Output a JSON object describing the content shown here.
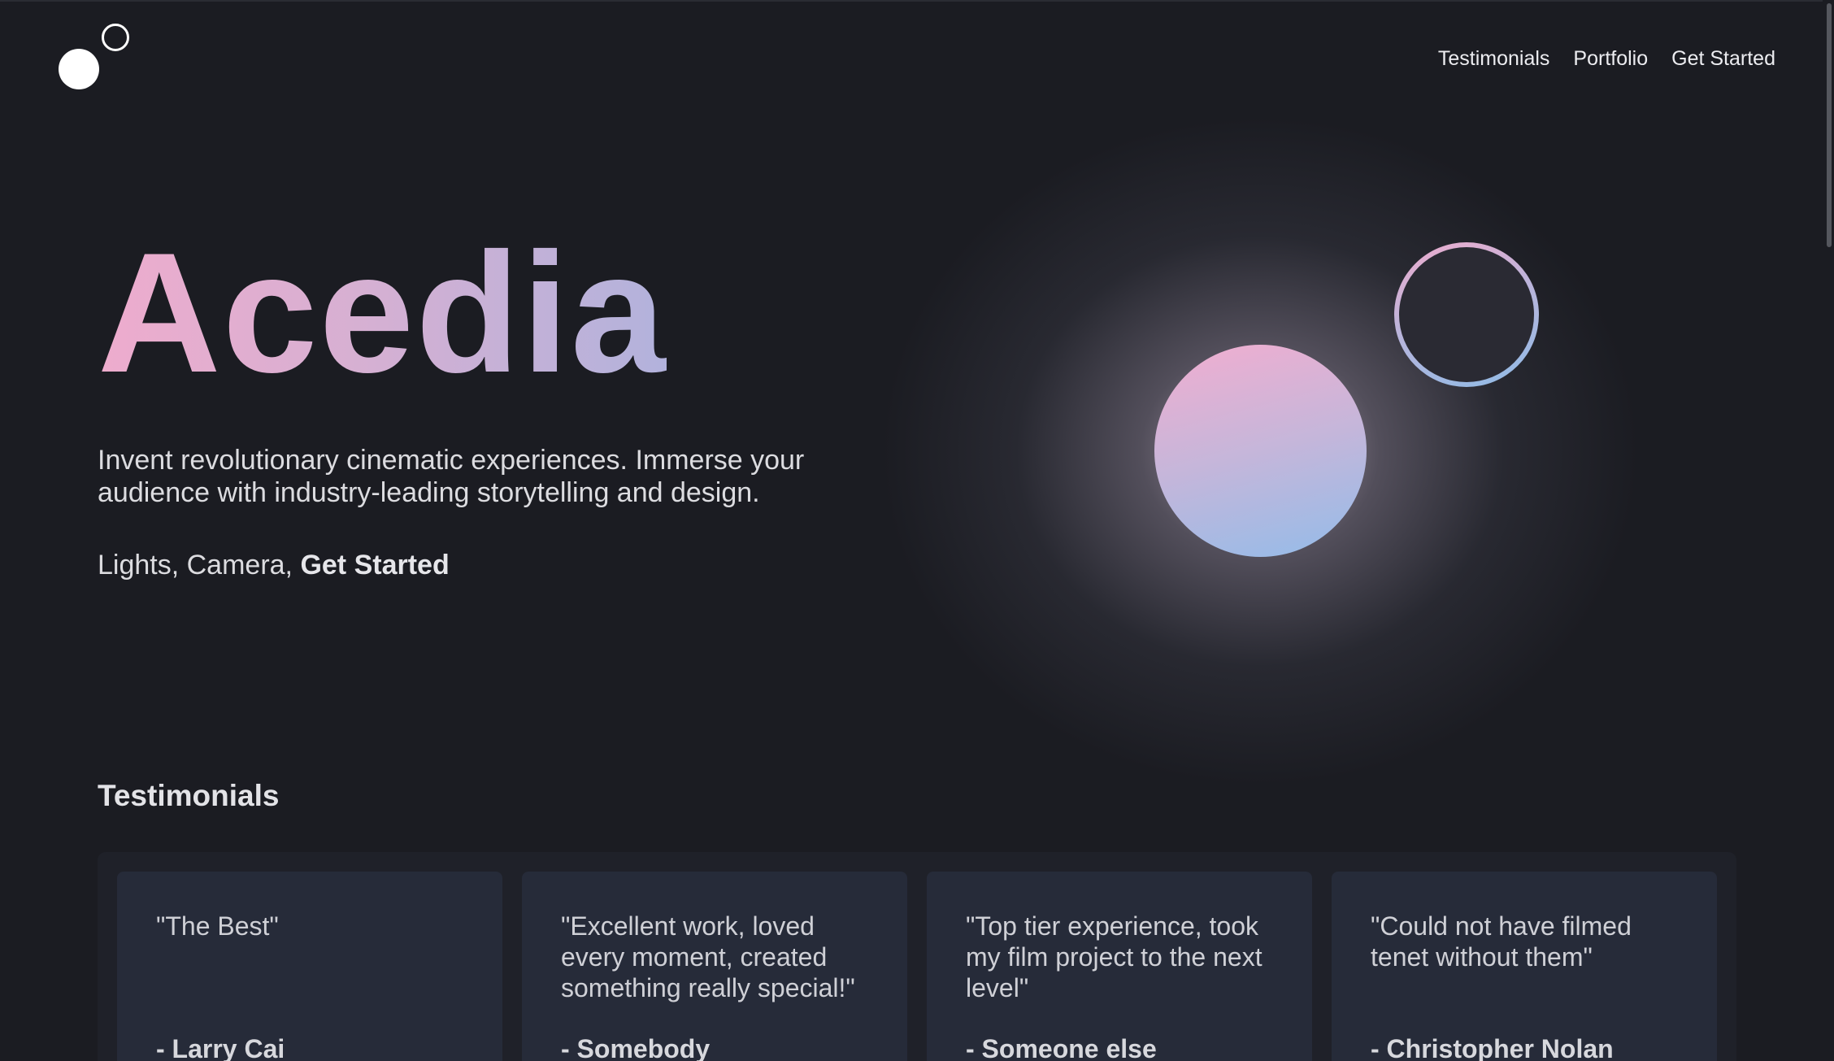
{
  "brand": {
    "logo_icon": "two-circles-logo"
  },
  "nav": {
    "items": [
      "Testimonials",
      "Portfolio",
      "Get Started"
    ]
  },
  "hero": {
    "title": "Acedia",
    "description": "Invent revolutionary cinematic experiences. Immerse your audience with industry-leading storytelling and design.",
    "cta_prefix": "Lights, Camera, ",
    "cta_link": "Get Started"
  },
  "testimonials": {
    "heading": "Testimonials",
    "items": [
      {
        "quote": "\"The Best\"",
        "author": "- Larry Cai"
      },
      {
        "quote": "\"Excellent work, loved every moment, created something really special!\"",
        "author": "- Somebody"
      },
      {
        "quote": "\"Top tier experience, took my film project to the next level\"",
        "author": "- Someone else"
      },
      {
        "quote": "\"Could not have filmed tenet without them\"",
        "author": "- Christopher Nolan"
      }
    ]
  },
  "colors": {
    "background": "#1b1c22",
    "gradient_pink": "#eeaccd",
    "gradient_blue": "#93bce9",
    "card": "#262b39"
  }
}
